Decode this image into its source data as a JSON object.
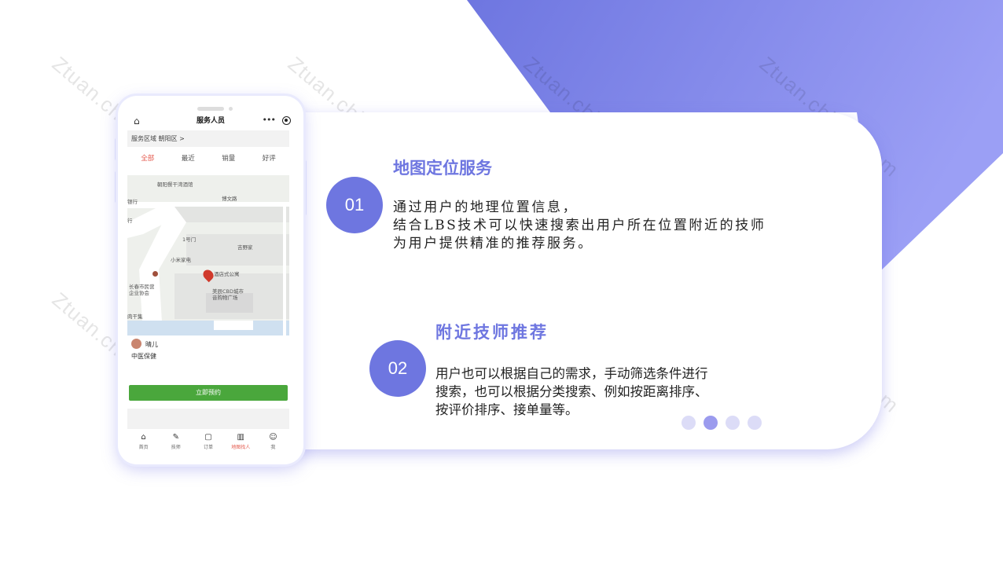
{
  "watermark": "Ztuan.chinaz.com",
  "phone": {
    "header": {
      "title": "服务人员"
    },
    "region_label": "服务区域",
    "region_value": "朝阳区 >",
    "tabs": [
      {
        "label": "全部"
      },
      {
        "label": "最近"
      },
      {
        "label": "销量"
      },
      {
        "label": "好评"
      }
    ],
    "map_labels": [
      "朝阳餐干湾酒馆",
      "博文路",
      "银行",
      "1号门",
      "吉野家",
      "小米家电",
      "长春市民营",
      "企业协会",
      "酒店式公寓",
      "美辰CBD城市",
      "音购物广场",
      "肉干集",
      "行"
    ],
    "technician": {
      "name": "晴儿",
      "category": "中医保健"
    },
    "book_button": "立即预约",
    "nav": [
      {
        "label": "首页",
        "icon": "home-icon"
      },
      {
        "label": "技师",
        "icon": "technician-icon"
      },
      {
        "label": "订单",
        "icon": "order-icon"
      },
      {
        "label": "地图找人",
        "icon": "map-icon"
      },
      {
        "label": "我",
        "icon": "profile-icon"
      }
    ],
    "accent_color": "#e45b4f",
    "button_color": "#4aa73c"
  },
  "section1": {
    "number": "01",
    "title": "地图定位服务",
    "lines": [
      "通过用户的地理位置信息，",
      "结合LBS技术可以快速搜索出用户所在位置附近的技师",
      "为用户提供精准的推荐服务。"
    ]
  },
  "section2": {
    "number": "02",
    "title": "附近技师推荐",
    "lines": [
      "用户也可以根据自己的需求，手动筛选条件进行",
      "搜索，也可以根据分类搜索、例如按距离排序、",
      "按评价排序、接单量等。"
    ]
  },
  "theme": {
    "primary": "#6e76e0",
    "gradient_end": "#9b9ff5"
  }
}
